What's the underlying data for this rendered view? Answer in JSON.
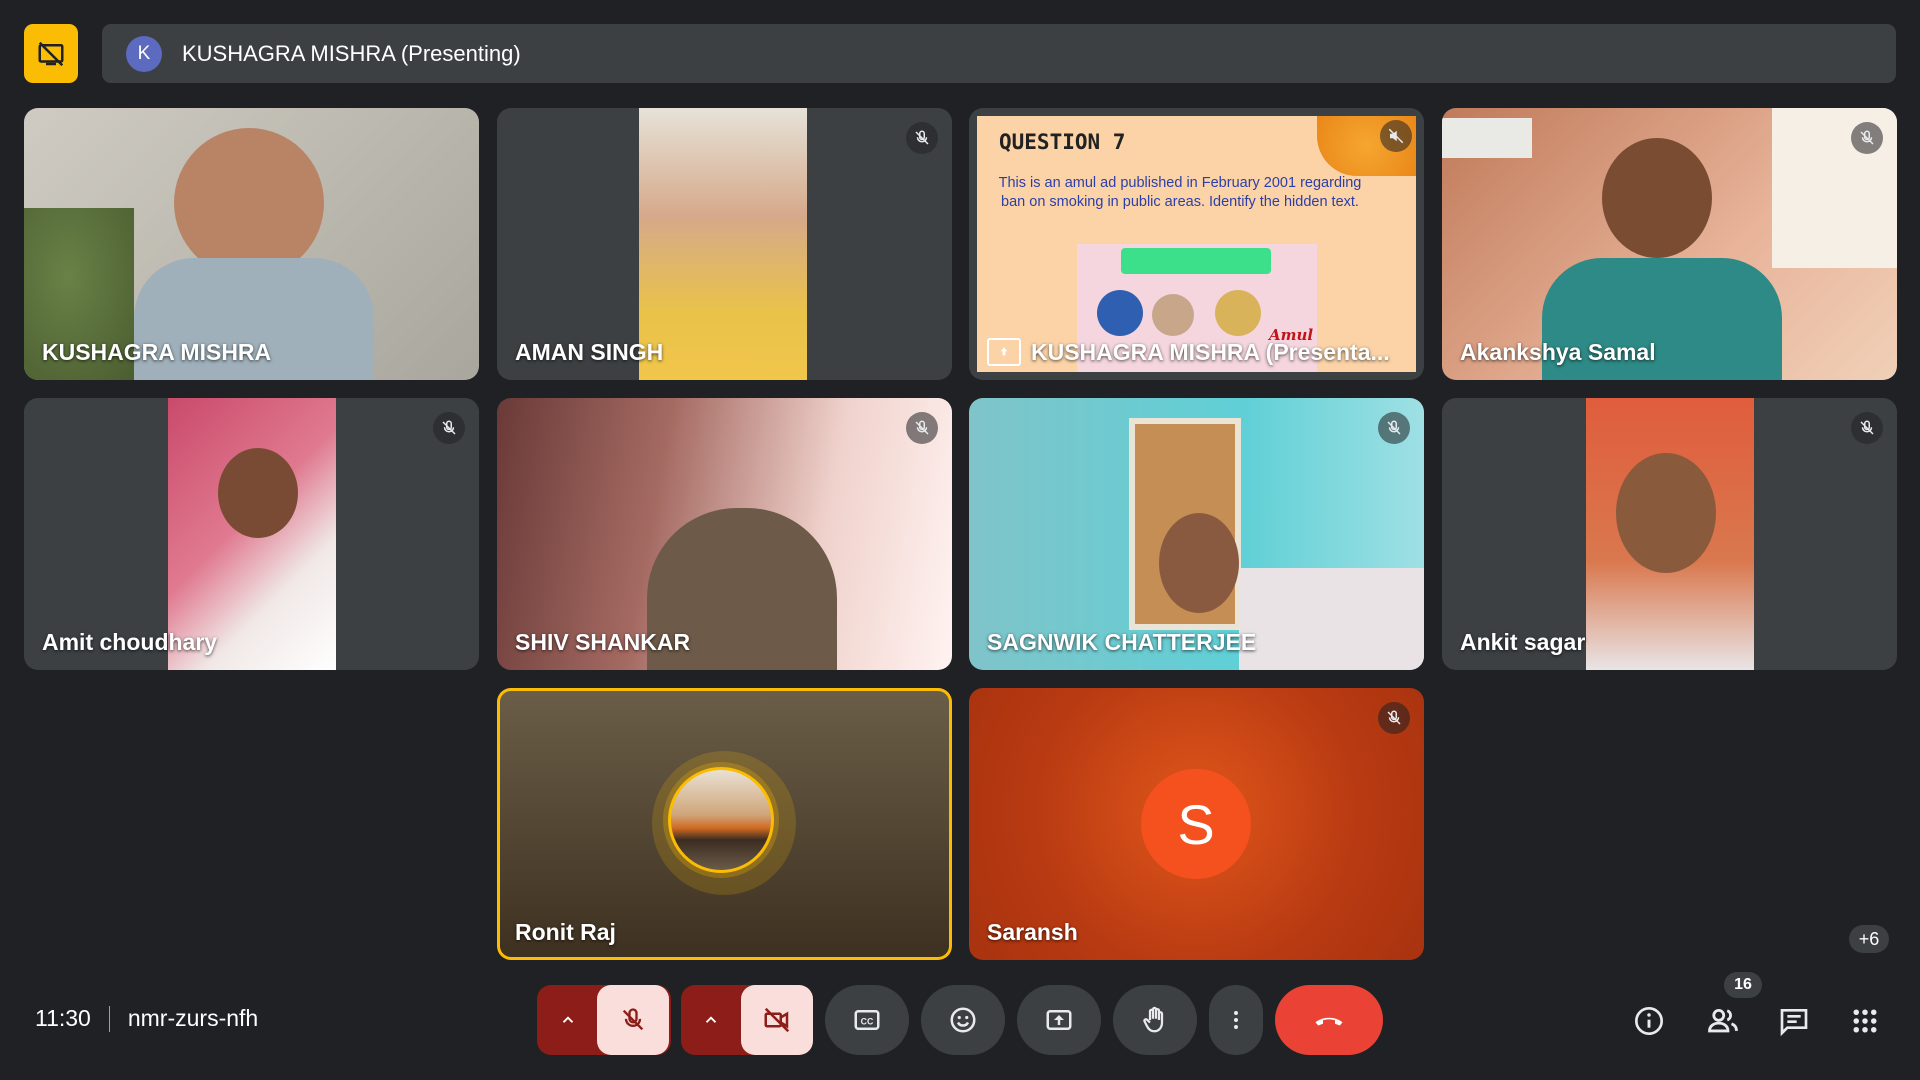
{
  "presentation": {
    "avatar_letter": "K",
    "presenter_label": "KUSHAGRA MISHRA (Presenting)"
  },
  "tiles": [
    {
      "name": "KUSHAGRA MISHRA",
      "muted": false
    },
    {
      "name": "AMAN SINGH",
      "muted": true
    },
    {
      "name": "KUSHAGRA MISHRA (Presenta...",
      "muted": true,
      "slide": {
        "heading": "QUESTION 7",
        "body": "This is an amul ad published in February 2001 regarding ban on smoking in public areas. Identify the hidden text.",
        "brand": "Amul"
      }
    },
    {
      "name": "Akankshya Samal",
      "muted": true
    },
    {
      "name": "Amit choudhary",
      "muted": true
    },
    {
      "name": "SHIV SHANKAR",
      "muted": true
    },
    {
      "name": "SAGNWIK CHATTERJEE",
      "muted": true
    },
    {
      "name": "Ankit sagar",
      "muted": true
    },
    {
      "name": "Ronit Raj",
      "muted": false,
      "speaking": true
    },
    {
      "name": "Saransh",
      "muted": true,
      "avatar_letter": "S"
    }
  ],
  "more_participants": "+6",
  "footer": {
    "time": "11:30",
    "meeting_code": "nmr-zurs-nfh",
    "people_count": "16"
  },
  "icons": {
    "present_stop": "present-off-icon",
    "mic": "mic-off-icon",
    "camera": "videocam-off-icon",
    "captions": "captions-icon",
    "emoji": "emoji-icon",
    "present": "present-to-all-icon",
    "hand": "raise-hand-icon",
    "more": "more-vert-icon",
    "leave": "call-end-icon",
    "info": "info-icon",
    "people": "people-icon",
    "chat": "chat-icon",
    "activities": "apps-icon"
  },
  "colors": {
    "background": "#202124",
    "tile": "#3c4043",
    "accent_yellow": "#fbbc04",
    "leave_red": "#ea4335",
    "muted_red_button": "#f9dedc",
    "saransh_avatar": "#f4511e"
  }
}
